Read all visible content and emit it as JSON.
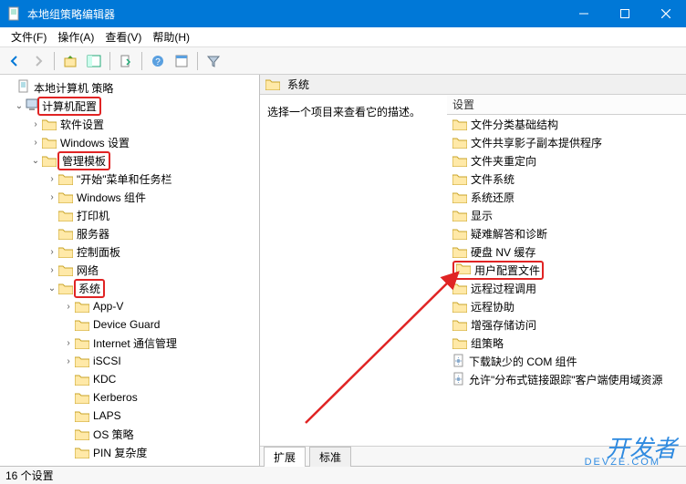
{
  "window": {
    "title": "本地组策略编辑器"
  },
  "menu": {
    "file": "文件(F)",
    "action": "操作(A)",
    "view": "查看(V)",
    "help": "帮助(H)"
  },
  "tree": {
    "root": "本地计算机 策略",
    "computer_config": "计算机配置",
    "software_settings": "软件设置",
    "windows_settings": "Windows 设置",
    "admin_templates": "管理模板",
    "start_taskbar": "\"开始\"菜单和任务栏",
    "win_components": "Windows 组件",
    "printers": "打印机",
    "servers": "服务器",
    "control_panel": "控制面板",
    "network": "网络",
    "system": "系统",
    "appv": "App-V",
    "device_guard": "Device Guard",
    "internet_comm": "Internet 通信管理",
    "iscsi": "iSCSI",
    "kdc": "KDC",
    "kerberos": "Kerberos",
    "laps": "LAPS",
    "os_policies": "OS 策略",
    "pin_complexity": "PIN 复杂度"
  },
  "content": {
    "header": "系统",
    "description": "选择一个项目来查看它的描述。",
    "settings_header": "设置",
    "items": [
      {
        "label": "文件分类基础结构",
        "type": "folder"
      },
      {
        "label": "文件共享影子副本提供程序",
        "type": "folder"
      },
      {
        "label": "文件夹重定向",
        "type": "folder"
      },
      {
        "label": "文件系统",
        "type": "folder"
      },
      {
        "label": "系统还原",
        "type": "folder"
      },
      {
        "label": "显示",
        "type": "folder"
      },
      {
        "label": "疑难解答和诊断",
        "type": "folder"
      },
      {
        "label": "硬盘 NV 缓存",
        "type": "folder"
      },
      {
        "label": "用户配置文件",
        "type": "folder",
        "highlight": true
      },
      {
        "label": "远程过程调用",
        "type": "folder"
      },
      {
        "label": "远程协助",
        "type": "folder"
      },
      {
        "label": "增强存储访问",
        "type": "folder"
      },
      {
        "label": "组策略",
        "type": "folder"
      },
      {
        "label": "下载缺少的 COM 组件",
        "type": "doc"
      },
      {
        "label": "允许\"分布式链接跟踪\"客户端使用域资源",
        "type": "doc"
      }
    ]
  },
  "tabs": {
    "extended": "扩展",
    "standard": "标准"
  },
  "status": {
    "count": "16 个设置"
  },
  "watermark": {
    "text": "开发者",
    "sub": "DEVZE.COM"
  }
}
